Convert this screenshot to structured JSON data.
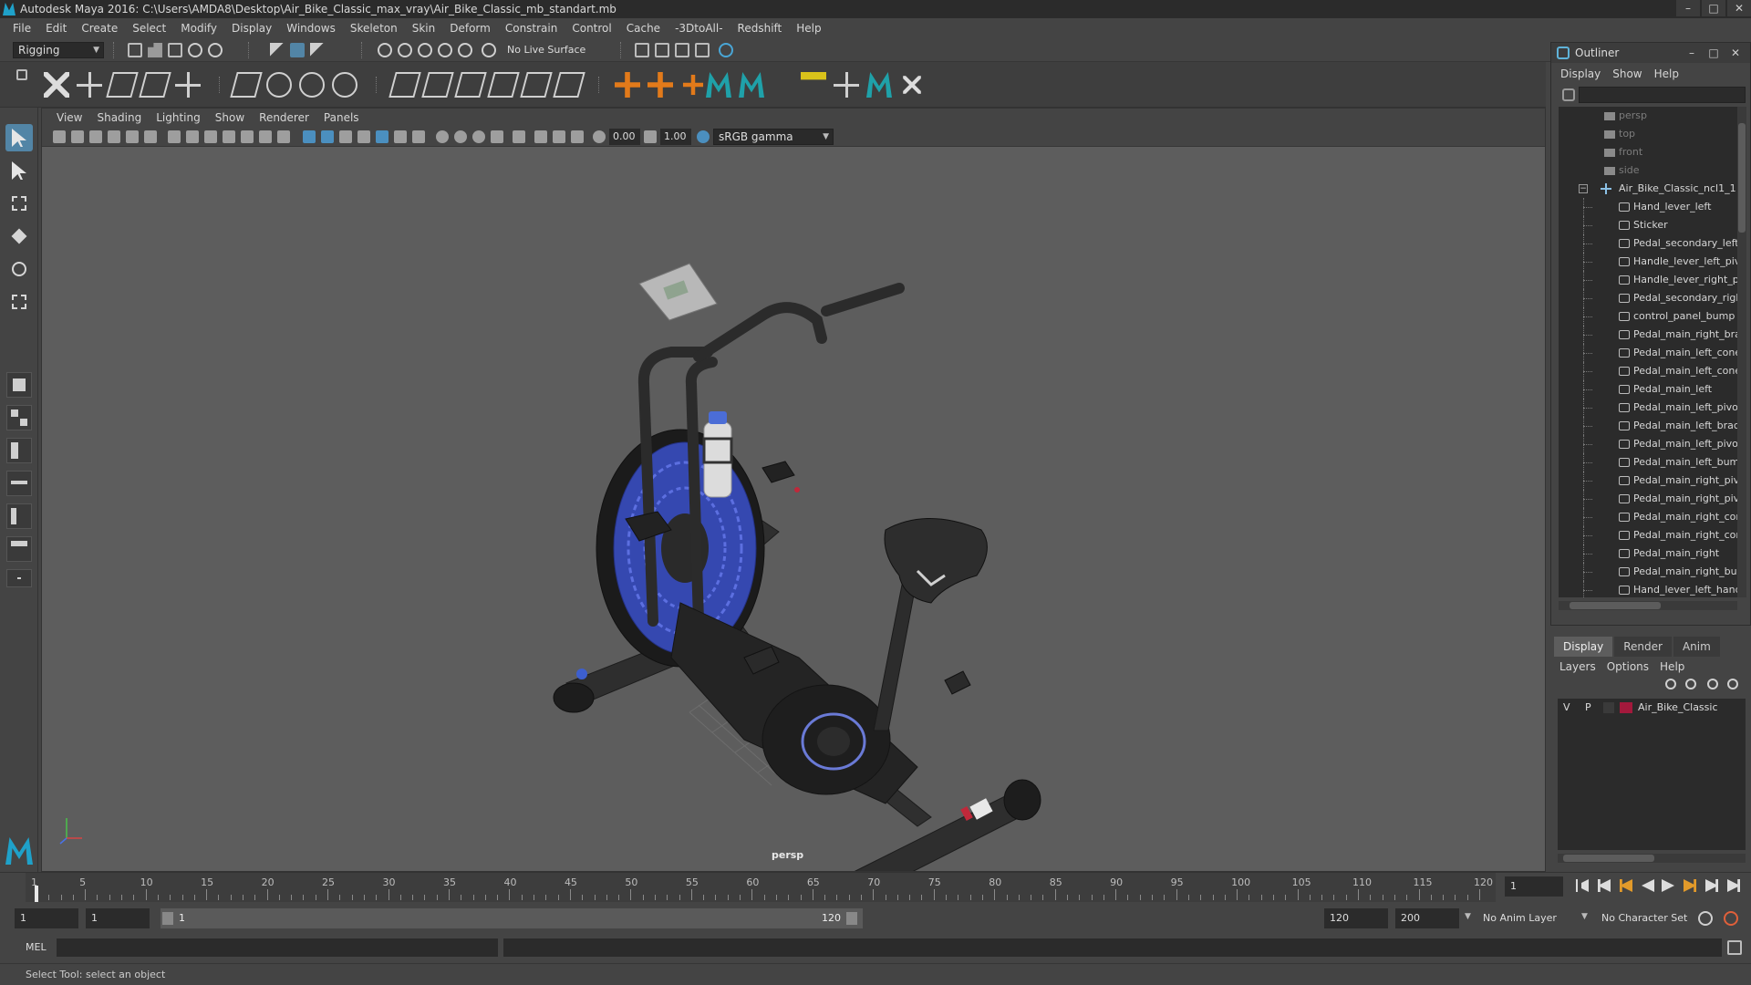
{
  "window": {
    "title": "Autodesk Maya 2016: C:\\Users\\AMDA8\\Desktop\\Air_Bike_Classic_max_vray\\Air_Bike_Classic_mb_standart.mb",
    "minimize": "–",
    "maximize": "□",
    "close": "✕"
  },
  "menubar": [
    "File",
    "Edit",
    "Create",
    "Select",
    "Modify",
    "Display",
    "Windows",
    "Skeleton",
    "Skin",
    "Deform",
    "Constrain",
    "Control",
    "Cache",
    "-3DtoAll-",
    "Redshift",
    "Help"
  ],
  "statusline": {
    "menuset": "Rigging",
    "live_surface": "No Live Surface"
  },
  "viewport": {
    "menu": [
      "View",
      "Shading",
      "Lighting",
      "Show",
      "Renderer",
      "Panels"
    ],
    "exposure": "0.00",
    "gamma": "1.00",
    "colorspace": "sRGB gamma",
    "camera_label": "persp",
    "background_color": "#5d5d5d"
  },
  "outliner": {
    "title": "Outliner",
    "menu": [
      "Display",
      "Show",
      "Help"
    ],
    "cameras": [
      "persp",
      "top",
      "front",
      "side"
    ],
    "root": "Air_Bike_Classic_ncl1_1",
    "items": [
      "Hand_lever_left",
      "Sticker",
      "Pedal_secondary_left_",
      "Handle_lever_left_pivo",
      "Handle_lever_right_pi",
      "Pedal_secondary_righ",
      "control_panel_bump",
      "Pedal_main_right_bra",
      "Pedal_main_left_cone",
      "Pedal_main_left_cone",
      "Pedal_main_left",
      "Pedal_main_left_pivot",
      "Pedal_main_left_brack",
      "Pedal_main_left_pivot",
      "Pedal_main_left_bump",
      "Pedal_main_right_pivo",
      "Pedal_main_right_pivo",
      "Pedal_main_right_con",
      "Pedal_main_right_con",
      "Pedal_main_right",
      "Pedal_main_right_bur",
      "Hand_lever_left_hand"
    ]
  },
  "layers": {
    "tabs": [
      "Display",
      "Render",
      "Anim"
    ],
    "active_tab": "Display",
    "menu": [
      "Layers",
      "Options",
      "Help"
    ],
    "rows": [
      {
        "v": "V",
        "p": "P",
        "color": "#a3193c",
        "name": "Air_Bike_Classic"
      }
    ]
  },
  "timeline": {
    "ticks": [
      "1",
      "5",
      "10",
      "15",
      "20",
      "25",
      "30",
      "35",
      "40",
      "45",
      "50",
      "55",
      "60",
      "65",
      "70",
      "75",
      "80",
      "85",
      "90",
      "95",
      "100",
      "105",
      "110",
      "115",
      "120"
    ],
    "current_frame": "1",
    "start_min": "1",
    "start": "1",
    "range_left": "1",
    "range_right": "120",
    "end": "120",
    "end_max": "200",
    "anim_layer": "No Anim Layer",
    "character_set": "No Character Set"
  },
  "cmdline": {
    "label": "MEL"
  },
  "help": {
    "text": "Select Tool: select an object"
  }
}
